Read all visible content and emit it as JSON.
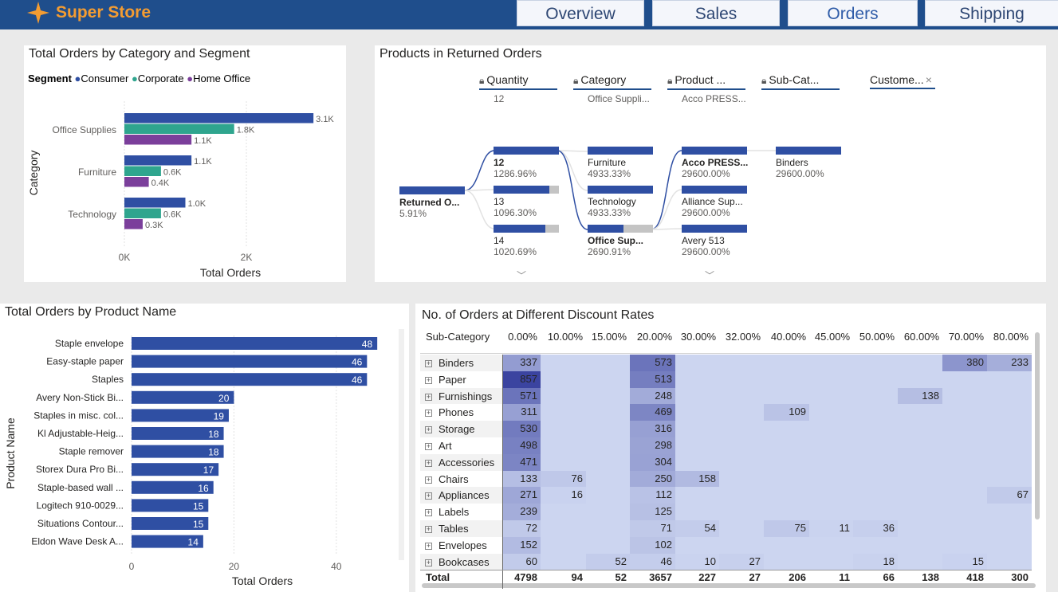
{
  "app": {
    "brand": "Super Store",
    "tabs": [
      "Overview",
      "Sales",
      "Orders",
      "Shipping"
    ],
    "active_tab": "Orders",
    "colors": {
      "header": "#1f4e8c",
      "brand": "#f39c32",
      "bar": "#2f4fa3",
      "consumer": "#2f4fa3",
      "corporate": "#2fa58e",
      "home_office": "#7b3f9b"
    }
  },
  "segment_chart": {
    "title": "Total Orders by Category and Segment",
    "legend_title": "Segment",
    "x_ticks": [
      "0K",
      "2K"
    ],
    "chart_data": {
      "type": "bar",
      "title": "Total Orders by Category and Segment",
      "xlabel": "Total Orders",
      "ylabel": "Category",
      "categories": [
        "Office Supplies",
        "Furniture",
        "Technology"
      ],
      "series": [
        {
          "name": "Consumer",
          "values": [
            3.1,
            1.1,
            1.0
          ],
          "labels": [
            "3.1K",
            "1.1K",
            "1.0K"
          ]
        },
        {
          "name": "Corporate",
          "values": [
            1.8,
            0.6,
            0.6
          ],
          "labels": [
            "1.8K",
            "0.6K",
            "0.6K"
          ]
        },
        {
          "name": "Home Office",
          "values": [
            1.1,
            0.4,
            0.3
          ],
          "labels": [
            "1.1K",
            "0.4K",
            "0.3K"
          ]
        }
      ],
      "xlim": [
        0,
        3.2
      ],
      "unit": "K",
      "orientation": "horizontal",
      "legend_position": "top-left",
      "grid": true
    }
  },
  "decomp": {
    "title": "Products in Returned Orders",
    "levels": [
      {
        "label": "Quantity",
        "value": "12"
      },
      {
        "label": "Category",
        "value": "Office Suppli..."
      },
      {
        "label": "Product ...",
        "value": "Acco PRESS..."
      },
      {
        "label": "Sub-Cat...",
        "value": ""
      },
      {
        "label": "Custome...",
        "value": ""
      }
    ],
    "root": {
      "label": "Returned O...",
      "value": "5.91%"
    },
    "col1": [
      {
        "label": "12",
        "value": "1286.96%",
        "fill": 1.0
      },
      {
        "label": "13",
        "value": "1096.30%",
        "fill": 0.85
      },
      {
        "label": "14",
        "value": "1020.69%",
        "fill": 0.79
      }
    ],
    "col2": [
      {
        "label": "Furniture",
        "value": "4933.33%",
        "fill": 1.0
      },
      {
        "label": "Technology",
        "value": "4933.33%",
        "fill": 1.0
      },
      {
        "label": "Office Sup...",
        "value": "2690.91%",
        "fill": 0.55
      }
    ],
    "col3": [
      {
        "label": "Acco PRESS...",
        "value": "29600.00%",
        "fill": 1.0
      },
      {
        "label": "Alliance Sup...",
        "value": "29600.00%",
        "fill": 1.0
      },
      {
        "label": "Avery 513",
        "value": "29600.00%",
        "fill": 1.0
      }
    ],
    "col4": [
      {
        "label": "Binders",
        "value": "29600.00%",
        "fill": 1.0
      }
    ]
  },
  "product_chart": {
    "title": "Total Orders by Product Name",
    "x_ticks": [
      "0",
      "20",
      "40"
    ],
    "chart_data": {
      "type": "bar",
      "title": "Total Orders by Product Name",
      "xlabel": "Total Orders",
      "ylabel": "Product Name",
      "categories": [
        "Staple envelope",
        "Easy-staple paper",
        "Staples",
        "Avery Non-Stick Bi...",
        "Staples in misc. col...",
        "Kl Adjustable-Heig...",
        "Staple remover",
        "Storex Dura Pro Bi...",
        "Staple-based wall ...",
        "Logitech 910-0029...",
        "Situations Contour...",
        "Eldon Wave Desk A..."
      ],
      "values": [
        48,
        46,
        46,
        20,
        19,
        18,
        18,
        17,
        16,
        15,
        15,
        14
      ],
      "xlim": [
        0,
        48
      ],
      "orientation": "horizontal",
      "grid": true
    }
  },
  "matrix": {
    "title": "No. of Orders at Different Discount Rates",
    "row_header": "Sub-Category",
    "columns": [
      "0.00%",
      "10.00%",
      "15.00%",
      "20.00%",
      "30.00%",
      "32.00%",
      "40.00%",
      "45.00%",
      "50.00%",
      "60.00%",
      "70.00%",
      "80.00%"
    ],
    "rows": [
      {
        "name": "Binders",
        "values": [
          337,
          null,
          null,
          573,
          null,
          null,
          null,
          null,
          null,
          null,
          380,
          233
        ]
      },
      {
        "name": "Paper",
        "values": [
          857,
          null,
          null,
          513,
          null,
          null,
          null,
          null,
          null,
          null,
          null,
          null
        ]
      },
      {
        "name": "Furnishings",
        "values": [
          571,
          null,
          null,
          248,
          null,
          null,
          null,
          null,
          null,
          138,
          null,
          null
        ]
      },
      {
        "name": "Phones",
        "values": [
          311,
          null,
          null,
          469,
          null,
          null,
          109,
          null,
          null,
          null,
          null,
          null
        ]
      },
      {
        "name": "Storage",
        "values": [
          530,
          null,
          null,
          316,
          null,
          null,
          null,
          null,
          null,
          null,
          null,
          null
        ]
      },
      {
        "name": "Art",
        "values": [
          498,
          null,
          null,
          298,
          null,
          null,
          null,
          null,
          null,
          null,
          null,
          null
        ]
      },
      {
        "name": "Accessories",
        "values": [
          471,
          null,
          null,
          304,
          null,
          null,
          null,
          null,
          null,
          null,
          null,
          null
        ]
      },
      {
        "name": "Chairs",
        "values": [
          133,
          76,
          null,
          250,
          158,
          null,
          null,
          null,
          null,
          null,
          null,
          null
        ]
      },
      {
        "name": "Appliances",
        "values": [
          271,
          16,
          null,
          112,
          null,
          null,
          null,
          null,
          null,
          null,
          null,
          67
        ]
      },
      {
        "name": "Labels",
        "values": [
          239,
          null,
          null,
          125,
          null,
          null,
          null,
          null,
          null,
          null,
          null,
          null
        ]
      },
      {
        "name": "Tables",
        "values": [
          72,
          null,
          null,
          71,
          54,
          null,
          75,
          11,
          36,
          null,
          null,
          null
        ]
      },
      {
        "name": "Envelopes",
        "values": [
          152,
          null,
          null,
          102,
          null,
          null,
          null,
          null,
          null,
          null,
          null,
          null
        ]
      },
      {
        "name": "Bookcases",
        "values": [
          60,
          null,
          52,
          46,
          10,
          27,
          null,
          null,
          18,
          null,
          15,
          null
        ]
      }
    ],
    "total_label": "Total",
    "totals": [
      4798,
      94,
      52,
      3657,
      227,
      27,
      206,
      11,
      66,
      138,
      418,
      300
    ]
  }
}
